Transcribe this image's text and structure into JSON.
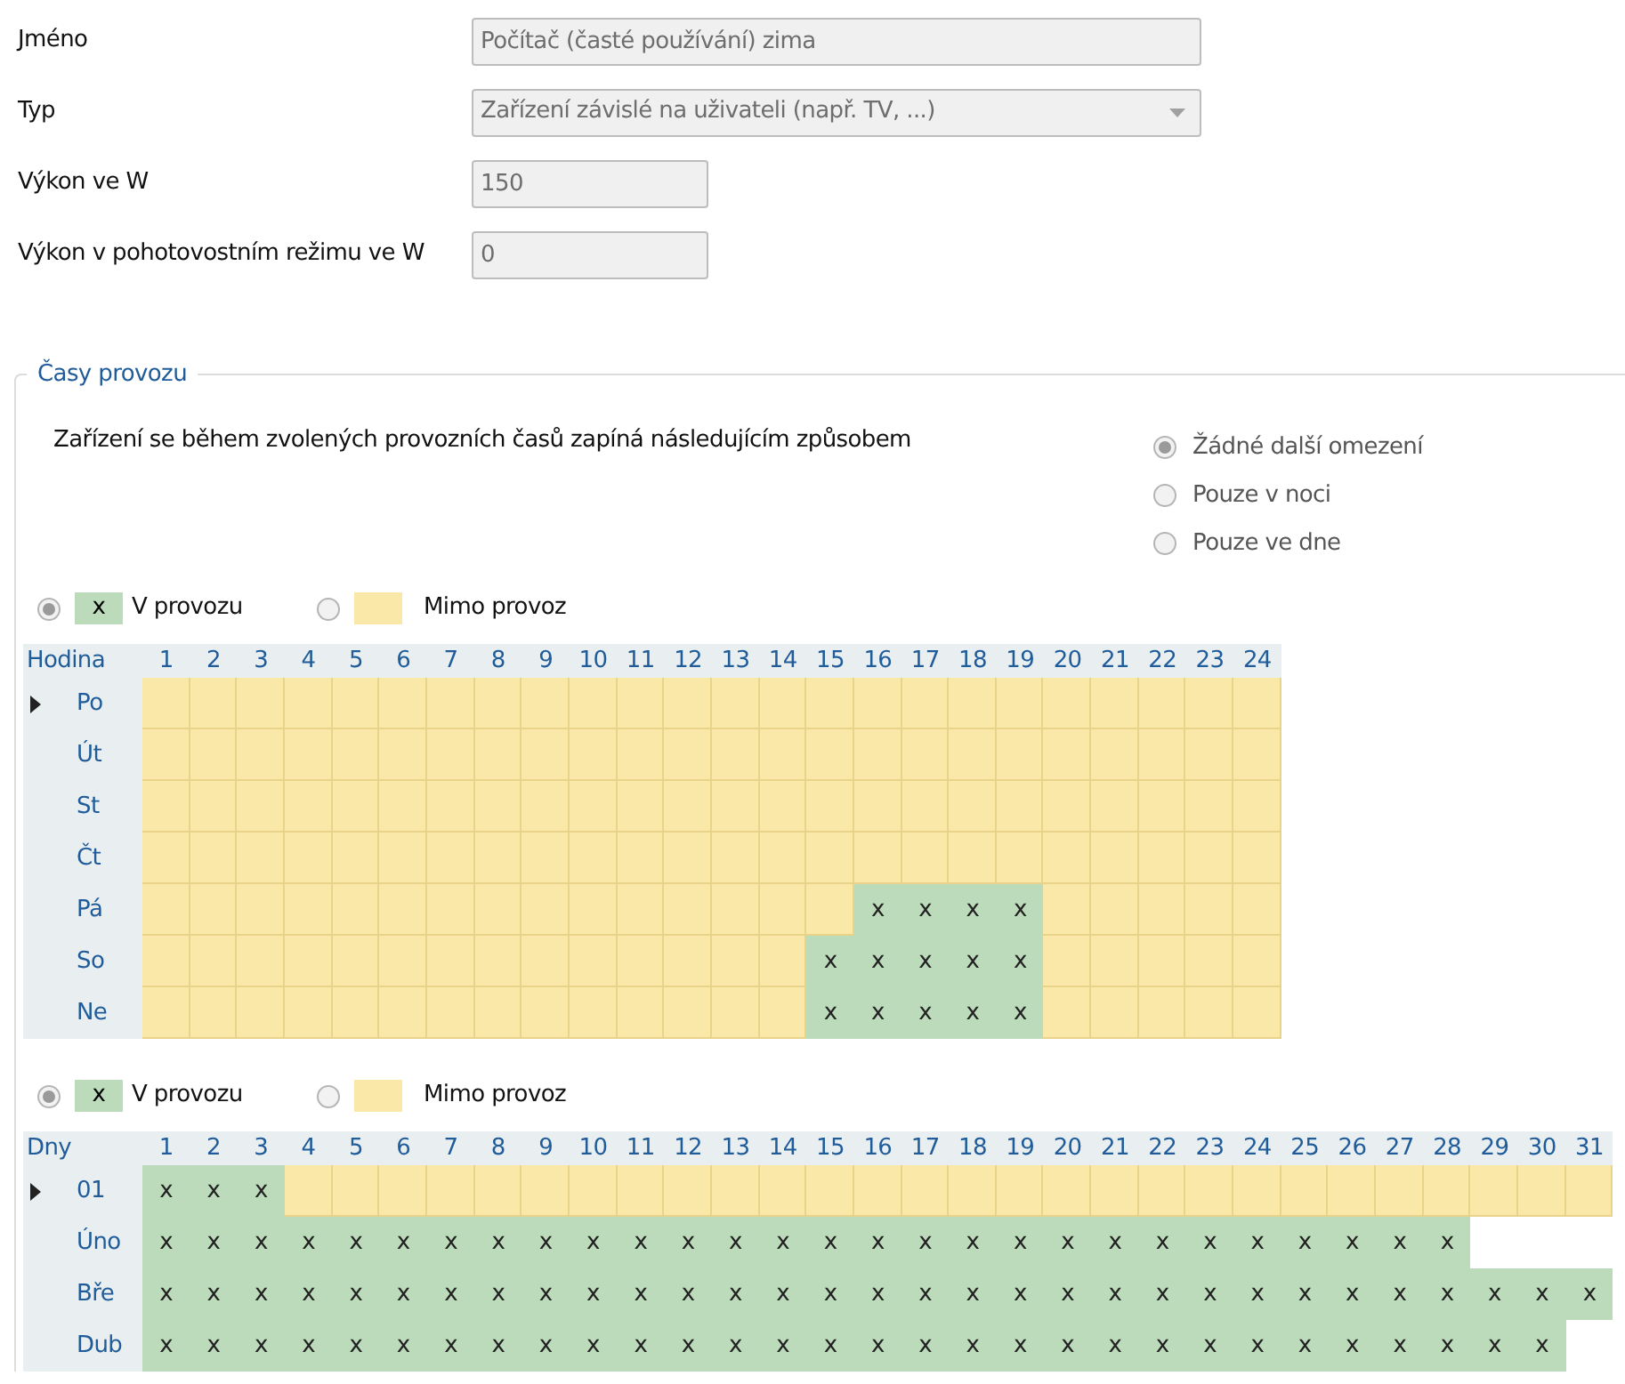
{
  "fields": [
    {
      "kind": "text",
      "label": "Jméno",
      "value": "Počítač (časté používání) zima",
      "wide": true
    },
    {
      "kind": "select",
      "label": "Typ",
      "value": "Zařízení závislé na uživateli (např. TV, ...)",
      "wide": true
    },
    {
      "kind": "text",
      "label": "Výkon ve W",
      "value": "150",
      "wide": false
    },
    {
      "kind": "text",
      "label": "Výkon v pohotovostním režimu ve W",
      "value": "0",
      "wide": false
    }
  ],
  "group": {
    "title": "Časy provozu",
    "description": "Zařízení se během zvolených provozních časů zapíná následujícím způsobem",
    "options": [
      {
        "label": "Žádné další omezení",
        "selected": true
      },
      {
        "label": "Pouze v noci",
        "selected": false
      },
      {
        "label": "Pouze ve dne",
        "selected": false
      }
    ],
    "grids": [
      {
        "legend": [
          {
            "label": "V provozu",
            "mark": "x",
            "on": true,
            "selected": true
          },
          {
            "label": "Mimo provoz",
            "on": false,
            "selected": false
          }
        ],
        "corner": "Hodina",
        "columns": [
          "1",
          "2",
          "3",
          "4",
          "5",
          "6",
          "7",
          "8",
          "9",
          "10",
          "11",
          "12",
          "13",
          "14",
          "15",
          "16",
          "17",
          "18",
          "19",
          "20",
          "21",
          "22",
          "23",
          "24"
        ],
        "rows": [
          {
            "label": "Po",
            "current": true,
            "cells": [
              {
                "on": false
              },
              {
                "on": false
              },
              {
                "on": false
              },
              {
                "on": false
              },
              {
                "on": false
              },
              {
                "on": false
              },
              {
                "on": false
              },
              {
                "on": false
              },
              {
                "on": false
              },
              {
                "on": false
              },
              {
                "on": false
              },
              {
                "on": false
              },
              {
                "on": false
              },
              {
                "on": false
              },
              {
                "on": false
              },
              {
                "on": false
              },
              {
                "on": false
              },
              {
                "on": false
              },
              {
                "on": false
              },
              {
                "on": false
              },
              {
                "on": false
              },
              {
                "on": false
              },
              {
                "on": false
              },
              {
                "on": false
              }
            ]
          },
          {
            "label": "Út",
            "current": false,
            "cells": [
              {
                "on": false
              },
              {
                "on": false
              },
              {
                "on": false
              },
              {
                "on": false
              },
              {
                "on": false
              },
              {
                "on": false
              },
              {
                "on": false
              },
              {
                "on": false
              },
              {
                "on": false
              },
              {
                "on": false
              },
              {
                "on": false
              },
              {
                "on": false
              },
              {
                "on": false
              },
              {
                "on": false
              },
              {
                "on": false
              },
              {
                "on": false
              },
              {
                "on": false
              },
              {
                "on": false
              },
              {
                "on": false
              },
              {
                "on": false
              },
              {
                "on": false
              },
              {
                "on": false
              },
              {
                "on": false
              },
              {
                "on": false
              }
            ]
          },
          {
            "label": "St",
            "current": false,
            "cells": [
              {
                "on": false
              },
              {
                "on": false
              },
              {
                "on": false
              },
              {
                "on": false
              },
              {
                "on": false
              },
              {
                "on": false
              },
              {
                "on": false
              },
              {
                "on": false
              },
              {
                "on": false
              },
              {
                "on": false
              },
              {
                "on": false
              },
              {
                "on": false
              },
              {
                "on": false
              },
              {
                "on": false
              },
              {
                "on": false
              },
              {
                "on": false
              },
              {
                "on": false
              },
              {
                "on": false
              },
              {
                "on": false
              },
              {
                "on": false
              },
              {
                "on": false
              },
              {
                "on": false
              },
              {
                "on": false
              },
              {
                "on": false
              }
            ]
          },
          {
            "label": "Čt",
            "current": false,
            "cells": [
              {
                "on": false
              },
              {
                "on": false
              },
              {
                "on": false
              },
              {
                "on": false
              },
              {
                "on": false
              },
              {
                "on": false
              },
              {
                "on": false
              },
              {
                "on": false
              },
              {
                "on": false
              },
              {
                "on": false
              },
              {
                "on": false
              },
              {
                "on": false
              },
              {
                "on": false
              },
              {
                "on": false
              },
              {
                "on": false
              },
              {
                "on": false
              },
              {
                "on": false
              },
              {
                "on": false
              },
              {
                "on": false
              },
              {
                "on": false
              },
              {
                "on": false
              },
              {
                "on": false
              },
              {
                "on": false
              },
              {
                "on": false
              }
            ]
          },
          {
            "label": "Pá",
            "current": false,
            "cells": [
              {
                "on": false
              },
              {
                "on": false
              },
              {
                "on": false
              },
              {
                "on": false
              },
              {
                "on": false
              },
              {
                "on": false
              },
              {
                "on": false
              },
              {
                "on": false
              },
              {
                "on": false
              },
              {
                "on": false
              },
              {
                "on": false
              },
              {
                "on": false
              },
              {
                "on": false
              },
              {
                "on": false
              },
              {
                "on": false
              },
              {
                "on": true,
                "mark": "x"
              },
              {
                "on": true,
                "mark": "x"
              },
              {
                "on": true,
                "mark": "x"
              },
              {
                "on": true,
                "mark": "x"
              },
              {
                "on": false
              },
              {
                "on": false
              },
              {
                "on": false
              },
              {
                "on": false
              },
              {
                "on": false
              }
            ]
          },
          {
            "label": "So",
            "current": false,
            "cells": [
              {
                "on": false
              },
              {
                "on": false
              },
              {
                "on": false
              },
              {
                "on": false
              },
              {
                "on": false
              },
              {
                "on": false
              },
              {
                "on": false
              },
              {
                "on": false
              },
              {
                "on": false
              },
              {
                "on": false
              },
              {
                "on": false
              },
              {
                "on": false
              },
              {
                "on": false
              },
              {
                "on": false
              },
              {
                "on": true,
                "mark": "x"
              },
              {
                "on": true,
                "mark": "x"
              },
              {
                "on": true,
                "mark": "x"
              },
              {
                "on": true,
                "mark": "x"
              },
              {
                "on": true,
                "mark": "x"
              },
              {
                "on": false
              },
              {
                "on": false
              },
              {
                "on": false
              },
              {
                "on": false
              },
              {
                "on": false
              }
            ]
          },
          {
            "label": "Ne",
            "current": false,
            "cells": [
              {
                "on": false
              },
              {
                "on": false
              },
              {
                "on": false
              },
              {
                "on": false
              },
              {
                "on": false
              },
              {
                "on": false
              },
              {
                "on": false
              },
              {
                "on": false
              },
              {
                "on": false
              },
              {
                "on": false
              },
              {
                "on": false
              },
              {
                "on": false
              },
              {
                "on": false
              },
              {
                "on": false
              },
              {
                "on": true,
                "mark": "x"
              },
              {
                "on": true,
                "mark": "x"
              },
              {
                "on": true,
                "mark": "x"
              },
              {
                "on": true,
                "mark": "x"
              },
              {
                "on": true,
                "mark": "x"
              },
              {
                "on": false
              },
              {
                "on": false
              },
              {
                "on": false
              },
              {
                "on": false
              },
              {
                "on": false
              }
            ]
          }
        ]
      },
      {
        "legend": [
          {
            "label": "V provozu",
            "mark": "x",
            "on": true,
            "selected": true
          },
          {
            "label": "Mimo provoz",
            "on": false,
            "selected": false
          }
        ],
        "corner": "Dny",
        "columns": [
          "1",
          "2",
          "3",
          "4",
          "5",
          "6",
          "7",
          "8",
          "9",
          "10",
          "11",
          "12",
          "13",
          "14",
          "15",
          "16",
          "17",
          "18",
          "19",
          "20",
          "21",
          "22",
          "23",
          "24",
          "25",
          "26",
          "27",
          "28",
          "29",
          "30",
          "31"
        ],
        "rows": [
          {
            "label": "01",
            "current": true,
            "cells": [
              {
                "on": true,
                "mark": "x"
              },
              {
                "on": true,
                "mark": "x"
              },
              {
                "on": true,
                "mark": "x"
              },
              {
                "on": false
              },
              {
                "on": false
              },
              {
                "on": false
              },
              {
                "on": false
              },
              {
                "on": false
              },
              {
                "on": false
              },
              {
                "on": false
              },
              {
                "on": false
              },
              {
                "on": false
              },
              {
                "on": false
              },
              {
                "on": false
              },
              {
                "on": false
              },
              {
                "on": false
              },
              {
                "on": false
              },
              {
                "on": false
              },
              {
                "on": false
              },
              {
                "on": false
              },
              {
                "on": false
              },
              {
                "on": false
              },
              {
                "on": false
              },
              {
                "on": false
              },
              {
                "on": false
              },
              {
                "on": false
              },
              {
                "on": false
              },
              {
                "on": false
              },
              {
                "on": false
              },
              {
                "on": false
              },
              {
                "on": false
              }
            ]
          },
          {
            "label": "Úno",
            "current": false,
            "cells": [
              {
                "on": true,
                "mark": "x"
              },
              {
                "on": true,
                "mark": "x"
              },
              {
                "on": true,
                "mark": "x"
              },
              {
                "on": true,
                "mark": "x"
              },
              {
                "on": true,
                "mark": "x"
              },
              {
                "on": true,
                "mark": "x"
              },
              {
                "on": true,
                "mark": "x"
              },
              {
                "on": true,
                "mark": "x"
              },
              {
                "on": true,
                "mark": "x"
              },
              {
                "on": true,
                "mark": "x"
              },
              {
                "on": true,
                "mark": "x"
              },
              {
                "on": true,
                "mark": "x"
              },
              {
                "on": true,
                "mark": "x"
              },
              {
                "on": true,
                "mark": "x"
              },
              {
                "on": true,
                "mark": "x"
              },
              {
                "on": true,
                "mark": "x"
              },
              {
                "on": true,
                "mark": "x"
              },
              {
                "on": true,
                "mark": "x"
              },
              {
                "on": true,
                "mark": "x"
              },
              {
                "on": true,
                "mark": "x"
              },
              {
                "on": true,
                "mark": "x"
              },
              {
                "on": true,
                "mark": "x"
              },
              {
                "on": true,
                "mark": "x"
              },
              {
                "on": true,
                "mark": "x"
              },
              {
                "on": true,
                "mark": "x"
              },
              {
                "on": true,
                "mark": "x"
              },
              {
                "on": true,
                "mark": "x"
              },
              {
                "on": true,
                "mark": "x"
              }
            ]
          },
          {
            "label": "Bře",
            "current": false,
            "cells": [
              {
                "on": true,
                "mark": "x"
              },
              {
                "on": true,
                "mark": "x"
              },
              {
                "on": true,
                "mark": "x"
              },
              {
                "on": true,
                "mark": "x"
              },
              {
                "on": true,
                "mark": "x"
              },
              {
                "on": true,
                "mark": "x"
              },
              {
                "on": true,
                "mark": "x"
              },
              {
                "on": true,
                "mark": "x"
              },
              {
                "on": true,
                "mark": "x"
              },
              {
                "on": true,
                "mark": "x"
              },
              {
                "on": true,
                "mark": "x"
              },
              {
                "on": true,
                "mark": "x"
              },
              {
                "on": true,
                "mark": "x"
              },
              {
                "on": true,
                "mark": "x"
              },
              {
                "on": true,
                "mark": "x"
              },
              {
                "on": true,
                "mark": "x"
              },
              {
                "on": true,
                "mark": "x"
              },
              {
                "on": true,
                "mark": "x"
              },
              {
                "on": true,
                "mark": "x"
              },
              {
                "on": true,
                "mark": "x"
              },
              {
                "on": true,
                "mark": "x"
              },
              {
                "on": true,
                "mark": "x"
              },
              {
                "on": true,
                "mark": "x"
              },
              {
                "on": true,
                "mark": "x"
              },
              {
                "on": true,
                "mark": "x"
              },
              {
                "on": true,
                "mark": "x"
              },
              {
                "on": true,
                "mark": "x"
              },
              {
                "on": true,
                "mark": "x"
              },
              {
                "on": true,
                "mark": "x"
              },
              {
                "on": true,
                "mark": "x"
              },
              {
                "on": true,
                "mark": "x"
              }
            ]
          },
          {
            "label": "Dub",
            "current": false,
            "cells": [
              {
                "on": true,
                "mark": "x"
              },
              {
                "on": true,
                "mark": "x"
              },
              {
                "on": true,
                "mark": "x"
              },
              {
                "on": true,
                "mark": "x"
              },
              {
                "on": true,
                "mark": "x"
              },
              {
                "on": true,
                "mark": "x"
              },
              {
                "on": true,
                "mark": "x"
              },
              {
                "on": true,
                "mark": "x"
              },
              {
                "on": true,
                "mark": "x"
              },
              {
                "on": true,
                "mark": "x"
              },
              {
                "on": true,
                "mark": "x"
              },
              {
                "on": true,
                "mark": "x"
              },
              {
                "on": true,
                "mark": "x"
              },
              {
                "on": true,
                "mark": "x"
              },
              {
                "on": true,
                "mark": "x"
              },
              {
                "on": true,
                "mark": "x"
              },
              {
                "on": true,
                "mark": "x"
              },
              {
                "on": true,
                "mark": "x"
              },
              {
                "on": true,
                "mark": "x"
              },
              {
                "on": true,
                "mark": "x"
              },
              {
                "on": true,
                "mark": "x"
              },
              {
                "on": true,
                "mark": "x"
              },
              {
                "on": true,
                "mark": "x"
              },
              {
                "on": true,
                "mark": "x"
              },
              {
                "on": true,
                "mark": "x"
              },
              {
                "on": true,
                "mark": "x"
              },
              {
                "on": true,
                "mark": "x"
              },
              {
                "on": true,
                "mark": "x"
              },
              {
                "on": true,
                "mark": "x"
              },
              {
                "on": true,
                "mark": "x"
              }
            ]
          }
        ]
      }
    ]
  }
}
